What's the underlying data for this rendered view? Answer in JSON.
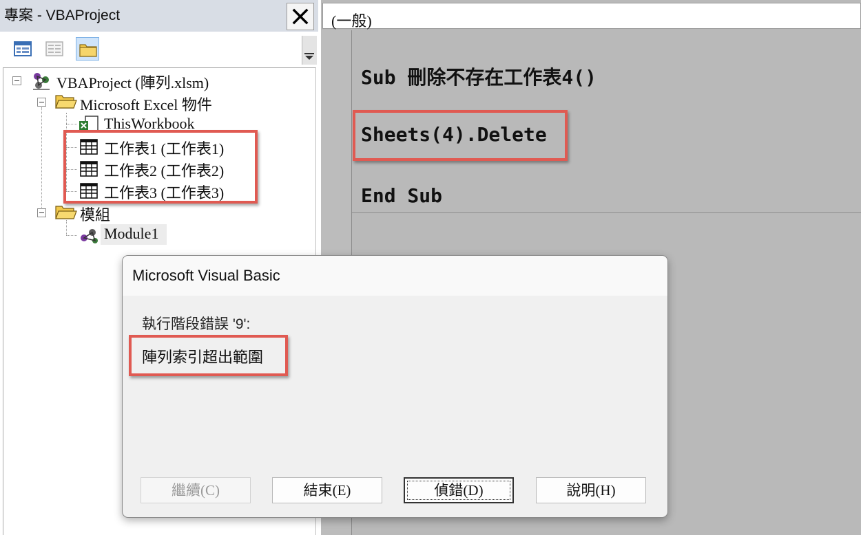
{
  "project": {
    "title": "專案 - VBAProject",
    "tree": {
      "root": "VBAProject (陣列.xlsm)",
      "excel_objects": "Microsoft Excel 物件",
      "this_workbook": "ThisWorkbook",
      "sheets": [
        "工作表1 (工作表1)",
        "工作表2 (工作表2)",
        "工作表3 (工作表3)"
      ],
      "modules_folder": "模組",
      "module1": "Module1"
    }
  },
  "code": {
    "proc_dropdown": "(一般)",
    "lines": [
      "Sub 刪除不存在工作表4()",
      "Sheets(4).Delete",
      "End Sub"
    ]
  },
  "dialog": {
    "title": "Microsoft Visual Basic",
    "error_heading": "執行階段錯誤 '9':",
    "error_message": "陣列索引超出範圍",
    "buttons": {
      "continue": "繼續(C)",
      "end": "結束(E)",
      "debug": "偵錯(D)",
      "help": "說明(H)"
    }
  },
  "colors": {
    "highlight_red": "#e05a52",
    "code_background": "#b9b9b9",
    "dialog_background": "#f0f0f0"
  }
}
